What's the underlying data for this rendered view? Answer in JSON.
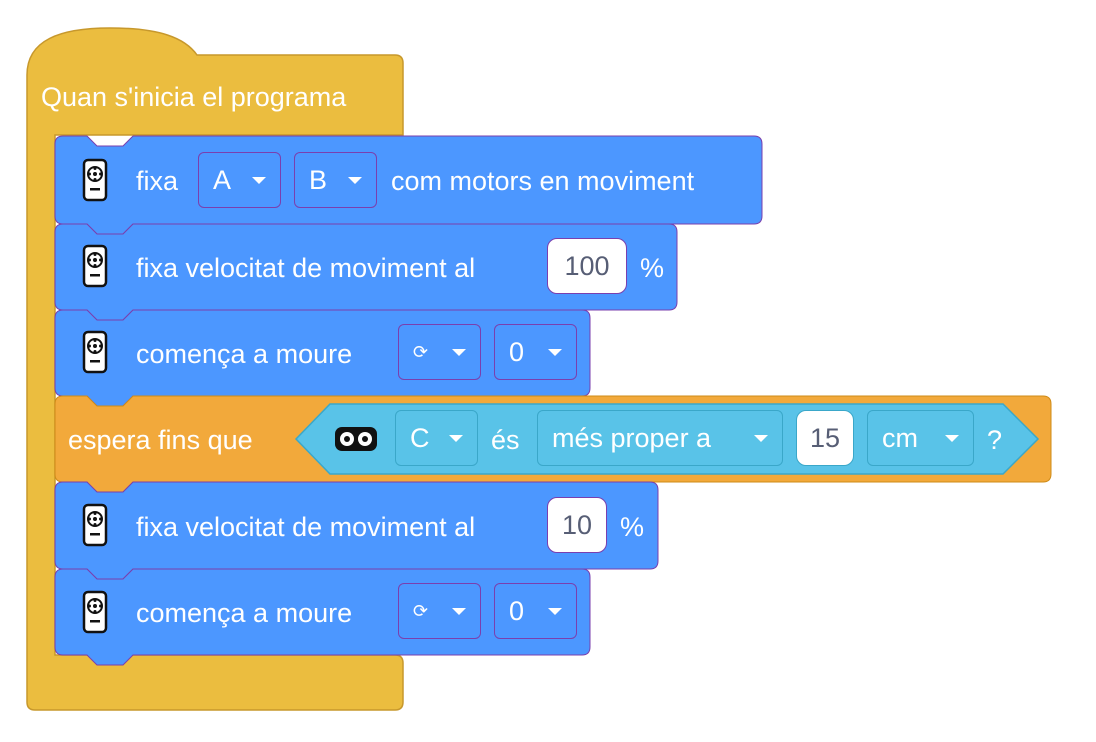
{
  "hat": {
    "label": "Quan s'inicia el programa"
  },
  "blocks": [
    {
      "prefix": "fixa",
      "dropdowns": [
        "A",
        "B"
      ],
      "suffix": "com motors en moviment"
    },
    {
      "prefix": "fixa velocitat de moviment al",
      "value": "100",
      "suffix": "%"
    },
    {
      "prefix": "comença a moure",
      "dropdowns": [
        "⟳",
        "0"
      ]
    },
    {
      "prefix": "espera fins que",
      "condition": {
        "port": "C",
        "verb": "és",
        "comparator": "més proper a",
        "value": "15",
        "unit": "cm",
        "end": "?"
      }
    },
    {
      "prefix": "fixa velocitat de moviment al",
      "value": "10",
      "suffix": "%"
    },
    {
      "prefix": "comença a moure",
      "dropdowns": [
        "⟳",
        "0"
      ]
    }
  ],
  "icons": {
    "motor_block_icon": "remote-control-icon",
    "distance_sensor_icon": "distance-sensor-icon"
  },
  "colors": {
    "events": "#ebbd3f",
    "motion": "#4c97ff",
    "control": "#f2a93b",
    "sensor": "#59c3e8",
    "border": "#7a3fae"
  }
}
